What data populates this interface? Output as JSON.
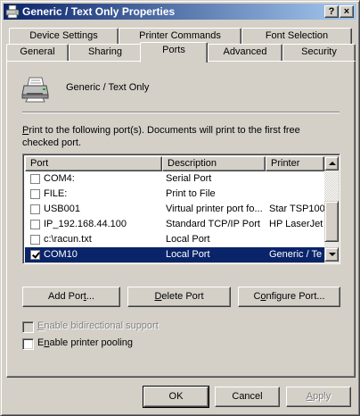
{
  "window": {
    "title": "Generic / Text Only Properties",
    "help_button": "?",
    "close_button": "×"
  },
  "tabs": {
    "row1": [
      "Device Settings",
      "Printer Commands",
      "Font Selection"
    ],
    "row2": [
      "General",
      "Sharing",
      "Ports",
      "Advanced",
      "Security"
    ],
    "active": "Ports"
  },
  "printer": {
    "name": "Generic / Text Only",
    "icon": "printer-icon"
  },
  "instructions": {
    "line1_accel": "P",
    "line1_rest": "rint to the following port(s). Documents will print to the first free",
    "line2": "checked port."
  },
  "port_list": {
    "columns": [
      "Port",
      "Description",
      "Printer"
    ],
    "rows": [
      {
        "checked": false,
        "port": "COM4:",
        "description": "Serial Port",
        "printer": ""
      },
      {
        "checked": false,
        "port": "FILE:",
        "description": "Print to File",
        "printer": ""
      },
      {
        "checked": false,
        "port": "USB001",
        "description": "Virtual printer port fo...",
        "printer": "Star TSP100"
      },
      {
        "checked": false,
        "port": "IP_192.168.44.100",
        "description": "Standard TCP/IP Port",
        "printer": "HP LaserJet"
      },
      {
        "checked": false,
        "port": "c:\\racun.txt",
        "description": "Local Port",
        "printer": ""
      },
      {
        "checked": true,
        "port": "COM10",
        "description": "Local Port",
        "printer": "Generic / Te",
        "selected": true
      }
    ],
    "scroll_position": 0.85
  },
  "port_buttons": {
    "add_accel": "t",
    "add_pre": "Add Por",
    "add_post": "...",
    "delete_accel": "D",
    "delete_rest": "elete Port",
    "configure_pre": "C",
    "configure_accel": "o",
    "configure_post": "nfigure Port..."
  },
  "options": {
    "bidirectional_accel": "E",
    "bidirectional_rest": "nable bidirectional support",
    "bidirectional_checked": false,
    "bidirectional_enabled": false,
    "pooling_pre": "E",
    "pooling_accel": "n",
    "pooling_post": "able printer pooling",
    "pooling_checked": false
  },
  "dialog_buttons": {
    "ok": "OK",
    "cancel": "Cancel",
    "apply_accel": "A",
    "apply_rest": "pply"
  },
  "colors": {
    "face": "#d4d0c8",
    "title_start": "#0a246a",
    "title_end": "#a6caf0",
    "selection": "#0a246a"
  }
}
